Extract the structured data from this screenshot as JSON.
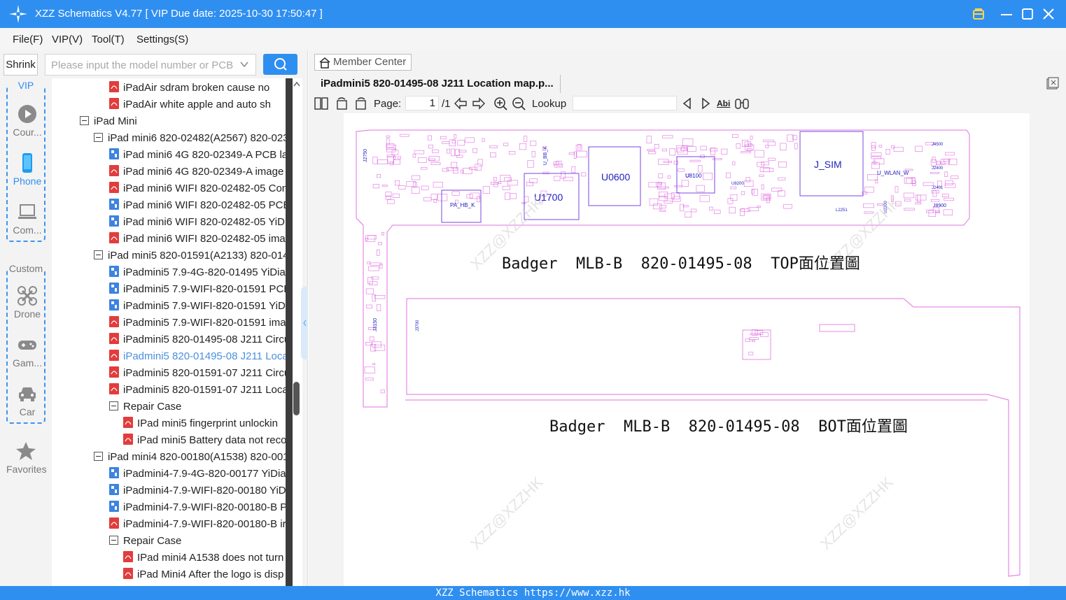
{
  "window": {
    "title": "XZZ Schematics V4.77 [ VIP Due date: 2025-10-30 17:50:47 ]",
    "accent_color": "#2f8ff0"
  },
  "menu": {
    "items": [
      "File(F)",
      "VIP(V)",
      "Tool(T)",
      "Settings(S)"
    ]
  },
  "sidebar": {
    "shrink_label": "Shrink",
    "search_placeholder": "Please input the model number or PCB",
    "vip_group_label": "VIP",
    "custom_group_label": "Custom",
    "categories": [
      {
        "label": "Cour...",
        "icon": "play-circle-icon"
      },
      {
        "label": "Phone",
        "icon": "phone-icon"
      },
      {
        "label": "Com...",
        "icon": "laptop-icon"
      },
      {
        "label": "Drone",
        "icon": "drone-icon"
      },
      {
        "label": "Gam...",
        "icon": "gamepad-icon"
      },
      {
        "label": "Car",
        "icon": "car-icon"
      }
    ],
    "favorites_label": "Favorites"
  },
  "tree": {
    "rows": [
      {
        "text": "iPadAir sdram broken cause no",
        "icon": "pdf-icon",
        "level": 3
      },
      {
        "text": "iPadAir white apple and auto sh",
        "icon": "pdf-icon",
        "level": 3
      },
      {
        "text": "iPad Mini",
        "icon": "expander",
        "level": 1
      },
      {
        "text": "iPad mini6 820-02482(A2567) 820-023",
        "icon": "expander",
        "level": 2
      },
      {
        "text": "iPad mini6 4G 820-02349-A PCB la",
        "icon": "pcb-icon",
        "level": 3
      },
      {
        "text": "iPad mini6 4G 820-02349-A image",
        "icon": "pdf-icon",
        "level": 3
      },
      {
        "text": "iPad mini6 WIFI 820-02482-05 Con",
        "icon": "pdf-icon",
        "level": 3
      },
      {
        "text": "iPad mini6 WIFI 820-02482-05 PCB",
        "icon": "pcb-icon",
        "level": 3
      },
      {
        "text": "iPad mini6 WIFI 820-02482-05 YiDi",
        "icon": "pcb-icon",
        "level": 3
      },
      {
        "text": "iPad mini6 WIFI 820-02482-05 ima",
        "icon": "pdf-icon",
        "level": 3
      },
      {
        "text": "iPad mini5 820-01591(A2133) 820-014",
        "icon": "expander",
        "level": 2
      },
      {
        "text": "iPadmini5 7.9-4G-820-01495 YiDia",
        "icon": "pcb-icon",
        "level": 3
      },
      {
        "text": "iPadmini5 7.9-WIFI-820-01591 PCB",
        "icon": "pcb-icon",
        "level": 3
      },
      {
        "text": "iPadmini5 7.9-WIFI-820-01591 YiDi",
        "icon": "pcb-icon",
        "level": 3
      },
      {
        "text": "iPadmini5 7.9-WIFI-820-01591 ima",
        "icon": "pdf-icon",
        "level": 3
      },
      {
        "text": "iPadmini5 820-01495-08 J211 Circu",
        "icon": "pdf-icon",
        "level": 3
      },
      {
        "text": "iPadmini5 820-01495-08 J211 Loca",
        "icon": "pdf-icon",
        "level": 3,
        "selected": true
      },
      {
        "text": "iPadmini5 820-01591-07 J211 Circu",
        "icon": "pdf-icon",
        "level": 3
      },
      {
        "text": "iPadmini5 820-01591-07 J211 Loca",
        "icon": "pdf-icon",
        "level": 3
      },
      {
        "text": "Repair Case",
        "icon": "expander",
        "level": 3
      },
      {
        "text": "IPad mini5 fingerprint unlockin",
        "icon": "pdf-icon",
        "level": 4
      },
      {
        "text": "iPad mini5 Battery data not reco",
        "icon": "pdf-icon",
        "level": 4
      },
      {
        "text": "iPad mini4 820-00180(A1538) 820-001",
        "icon": "expander",
        "level": 2
      },
      {
        "text": "iPadmini4-7.9-4G-820-00177 YiDia",
        "icon": "pcb-icon",
        "level": 3
      },
      {
        "text": "iPadmini4-7.9-WIFI-820-00180 YiD",
        "icon": "pcb-icon",
        "level": 3
      },
      {
        "text": "iPadmini4-7.9-WIFI-820-00180-B P",
        "icon": "pcb-icon",
        "level": 3
      },
      {
        "text": "iPadmini4-7.9-WIFI-820-00180-B ir",
        "icon": "pdf-icon",
        "level": 3
      },
      {
        "text": "Repair Case",
        "icon": "expander",
        "level": 3
      },
      {
        "text": "IPad mini4 A1538 does not turn",
        "icon": "pdf-icon",
        "level": 4
      },
      {
        "text": "iPad Mini4 After the logo is disp",
        "icon": "pdf-icon",
        "level": 4
      }
    ]
  },
  "main": {
    "member_center_label": "Member Center",
    "tab_title": "iPadmini5 820-01495-08 J211 Location map.p...",
    "page_label": "Page:",
    "page_current": "1",
    "page_total": "/1",
    "lookup_label": "Lookup",
    "lookup_value": "",
    "abi_label": "Abi"
  },
  "document": {
    "top_caption": "Badger  MLB-B  820-01495-08  TOP面位置圖",
    "bot_caption": "Badger  MLB-B  820-01495-08  BOT面位置圖",
    "watermark": "XZZ@XZZHK",
    "components": [
      "J2750",
      "U_BB_K",
      "U0600",
      "U8100",
      "J_SIM",
      "U_WLAN_W",
      "U1700",
      "PA_HB_K",
      "J4500",
      "J2400",
      "J2401",
      "J8900",
      "U2200",
      "J3150",
      "J3700",
      "L2251",
      "U8200"
    ],
    "outline_color": "#e070e0"
  },
  "status": {
    "text": "XZZ Schematics https://www.xzz.hk"
  }
}
